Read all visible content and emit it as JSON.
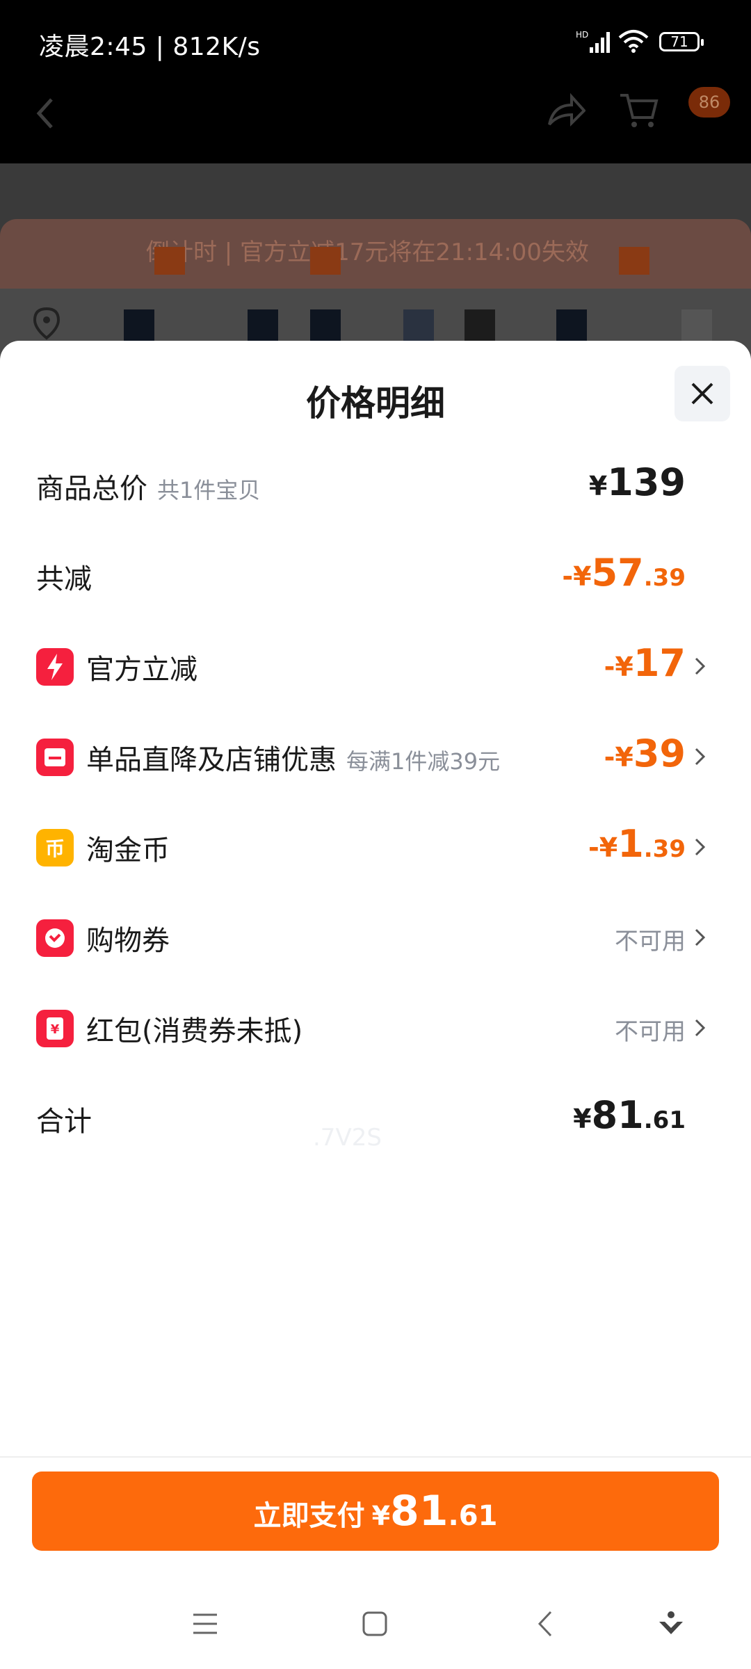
{
  "status_bar": {
    "time_speed": "凌晨2:45 | 812K/s",
    "battery": "71"
  },
  "app_header": {
    "cart_badge": "86"
  },
  "behind": {
    "banner_text": "倒计时 | 官方立减17元将在21:14:00失效"
  },
  "sheet": {
    "title": "价格明细",
    "rows": [
      {
        "label": "商品总价",
        "sub": "共1件宝贝",
        "prefix": "",
        "currency": "¥",
        "big": "139",
        "dec": ""
      },
      {
        "label": "共减",
        "sub": "",
        "prefix": "-",
        "currency": "¥",
        "big": "57",
        "dec": ".39"
      },
      {
        "label": "官方立减",
        "sub": "",
        "prefix": "-",
        "currency": "¥",
        "big": "17",
        "dec": "",
        "icon": "lightning-icon"
      },
      {
        "label": "单品直降及店铺优惠",
        "sub": "每满1件减39元",
        "prefix": "-",
        "currency": "¥",
        "big": "39",
        "dec": "",
        "icon": "shop-icon"
      },
      {
        "label": "淘金币",
        "sub": "",
        "prefix": "-",
        "currency": "¥",
        "big": "1",
        "dec": ".39",
        "icon": "coin-icon"
      },
      {
        "label": "购物券",
        "sub": "",
        "status": "不可用",
        "icon": "coupon-icon"
      },
      {
        "label": "红包(消费券未抵)",
        "sub": "",
        "status": "不可用",
        "icon": "red-packet-icon"
      },
      {
        "label": "合计",
        "sub": "",
        "prefix": "",
        "currency": "¥",
        "big": "81",
        "dec": ".61"
      }
    ],
    "watermark": ".7V2S"
  },
  "pay_button": {
    "label": "立即支付",
    "currency": "¥",
    "big": "81",
    "dec": ".61"
  },
  "colors": {
    "accent": "#fd6a0c",
    "price_orange": "#f2650a",
    "icon_red": "#f5203e",
    "icon_yellow": "#ffb300"
  }
}
